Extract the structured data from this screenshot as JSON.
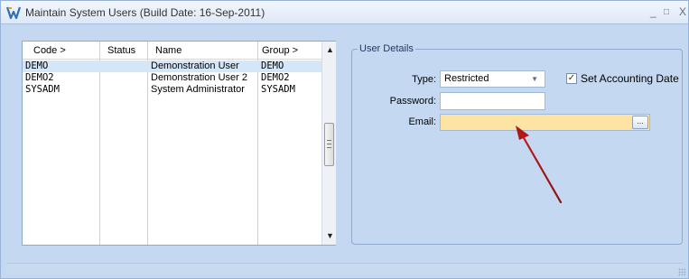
{
  "window": {
    "title": "Maintain System Users (Build Date: 16-Sep-2011)",
    "minimize": "_",
    "maximize": "□",
    "close": "X"
  },
  "user_list": {
    "columns": [
      "Code >",
      "Status",
      "Name",
      "Group >"
    ],
    "rows": [
      {
        "code": "DEMO",
        "status": "",
        "name": "Demonstration User",
        "group": "DEMO",
        "selected": true
      },
      {
        "code": "DEMO2",
        "status": "",
        "name": "Demonstration User 2",
        "group": "DEMO2",
        "selected": false
      },
      {
        "code": "SYSADM",
        "status": "",
        "name": "System Administrator",
        "group": "SYSADM",
        "selected": false
      }
    ],
    "scroll_up": "▲",
    "scroll_down": "▼"
  },
  "user_details": {
    "legend": "User Details",
    "type_label": "Type:",
    "type_value": "Restricted",
    "set_accounting_date_label": "Set Accounting Date",
    "set_accounting_date_checked": "✓",
    "password_label": "Password:",
    "password_value": "",
    "email_label": "Email:",
    "email_value": "",
    "email_button": "..."
  },
  "colors": {
    "window_bg": "#c4d8f1",
    "email_highlight": "#fde4a5",
    "annotation_arrow": "#b01818",
    "selected_row": "#d6e6f9"
  }
}
